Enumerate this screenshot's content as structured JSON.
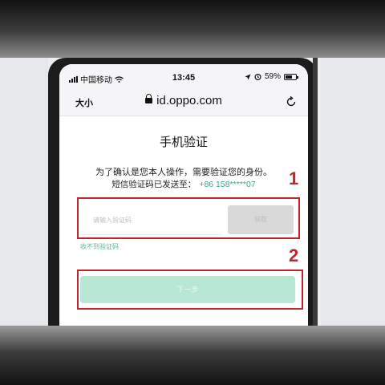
{
  "status_bar": {
    "carrier": "中国移动",
    "time": "13:45",
    "battery": "59%"
  },
  "address_bar": {
    "text_size_label": "大小",
    "domain": "id.oppo.com",
    "reload_icon": "reload-icon"
  },
  "page": {
    "title": "手机验证",
    "instruction": "为了确认是您本人操作，需要验证您的身份。",
    "sent_label": "短信验证码已发送至：",
    "masked_phone": "+86 158*****07",
    "code_placeholder": "请输入验证码",
    "send_button_label": "获取",
    "no_code_link": "收不到验证码",
    "next_button_label": "下一步"
  },
  "annotations": {
    "label_1": "1",
    "label_2": "2",
    "color": "#c0272d"
  },
  "colors": {
    "accent": "#3aa783",
    "next_button_bg": "#b9e7d5"
  }
}
